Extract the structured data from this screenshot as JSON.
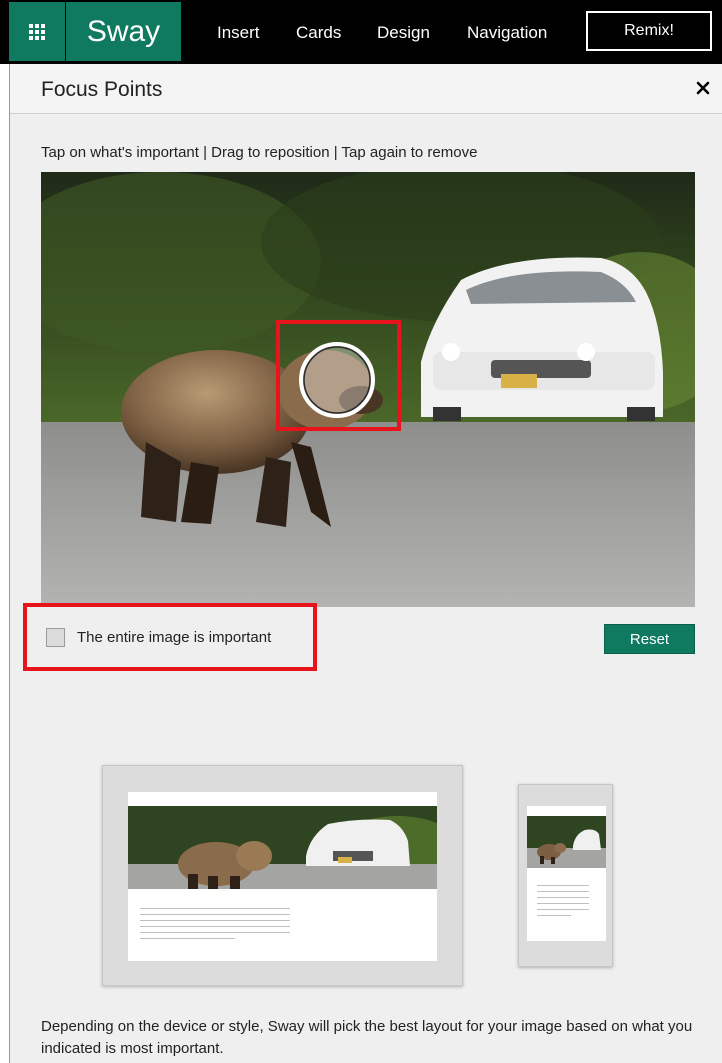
{
  "app": {
    "brand": "Sway",
    "nav": [
      "Insert",
      "Cards",
      "Design",
      "Navigation"
    ],
    "remix_label": "Remix!",
    "waffle_icon": "app-launcher-icon"
  },
  "panel": {
    "title": "Focus Points",
    "close_icon": "close-icon",
    "instructions": "Tap on what's important | Drag to reposition | Tap again to remove",
    "checkbox_label": "The entire image is important",
    "checkbox_checked": false,
    "reset_label": "Reset",
    "footer": "Depending on the device or style, Sway will pick the best layout for your image based on what you indicated is most important."
  },
  "colors": {
    "accent": "#0f7a5f",
    "topbar": "#000000",
    "highlight": "#e8141b",
    "panel_bg": "#efefef"
  }
}
